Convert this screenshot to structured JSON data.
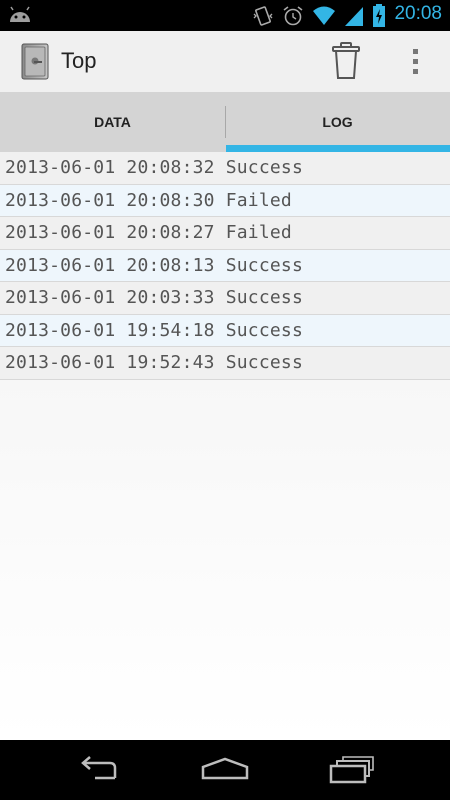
{
  "status_bar": {
    "time": "20:08",
    "icons": [
      "android-icon",
      "vibrate-icon",
      "alarm-icon",
      "wifi-icon",
      "signal-icon",
      "battery-charging-icon"
    ]
  },
  "action_bar": {
    "title": "Top",
    "app_icon": "safe-icon",
    "actions": [
      "trash-icon",
      "overflow-menu-icon"
    ]
  },
  "tabs": [
    {
      "label": "DATA",
      "selected": false
    },
    {
      "label": "LOG",
      "selected": true
    }
  ],
  "log": [
    "2013-06-01 20:08:32 Success",
    "2013-06-01 20:08:30 Failed",
    "2013-06-01 20:08:27 Failed",
    "2013-06-01 20:08:13 Success",
    "2013-06-01 20:03:33 Success",
    "2013-06-01 19:54:18 Success",
    "2013-06-01 19:52:43 Success"
  ],
  "nav_bar": {
    "buttons": [
      "back-icon",
      "home-icon",
      "recent-apps-icon"
    ]
  },
  "colors": {
    "accent": "#33b5e5"
  }
}
